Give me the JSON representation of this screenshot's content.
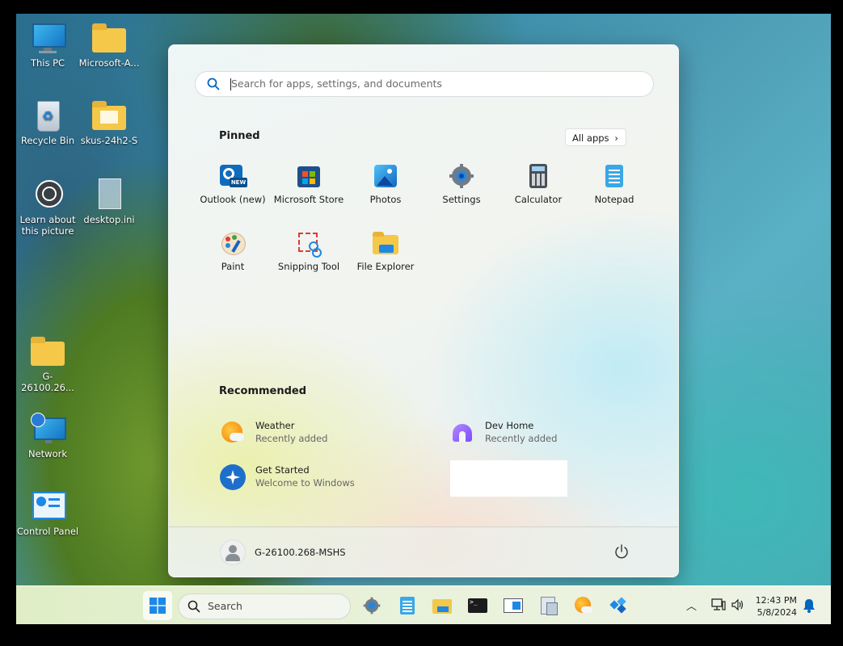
{
  "desktop": {
    "icons": [
      {
        "label": "This PC"
      },
      {
        "label": "Microsoft-A..."
      },
      {
        "label": "Recycle Bin"
      },
      {
        "label": "skus-24h2-S"
      },
      {
        "label": "Learn about this picture"
      },
      {
        "label": "desktop.ini"
      },
      {
        "label": "G-26100.26..."
      },
      {
        "label": "Network"
      },
      {
        "label": "Control Panel"
      }
    ]
  },
  "start_menu": {
    "search_placeholder": "Search for apps, settings, and documents",
    "pinned_title": "Pinned",
    "all_apps_label": "All apps",
    "pinned_apps": [
      {
        "label": "Outlook (new)",
        "icon": "outlook-icon"
      },
      {
        "label": "Microsoft Store",
        "icon": "store-icon"
      },
      {
        "label": "Photos",
        "icon": "photos-icon"
      },
      {
        "label": "Settings",
        "icon": "gear-icon"
      },
      {
        "label": "Calculator",
        "icon": "calculator-icon"
      },
      {
        "label": "Notepad",
        "icon": "notepad-icon"
      },
      {
        "label": "Paint",
        "icon": "paint-icon"
      },
      {
        "label": "Snipping Tool",
        "icon": "snipping-icon"
      },
      {
        "label": "File Explorer",
        "icon": "folder-icon"
      }
    ],
    "recommended_title": "Recommended",
    "recommended": [
      {
        "title": "Weather",
        "subtitle": "Recently added",
        "icon": "weather-icon"
      },
      {
        "title": "Dev Home",
        "subtitle": "Recently added",
        "icon": "devhome-icon"
      },
      {
        "title": "Get Started",
        "subtitle": "Welcome to Windows",
        "icon": "getstarted-icon"
      }
    ],
    "user_name": "G-26100.268-MSHS"
  },
  "taskbar": {
    "search_label": "Search",
    "time": "12:43 PM",
    "date": "5/8/2024"
  },
  "colors": {
    "accent": "#0067c0",
    "taskbar": "#e4efd2"
  }
}
